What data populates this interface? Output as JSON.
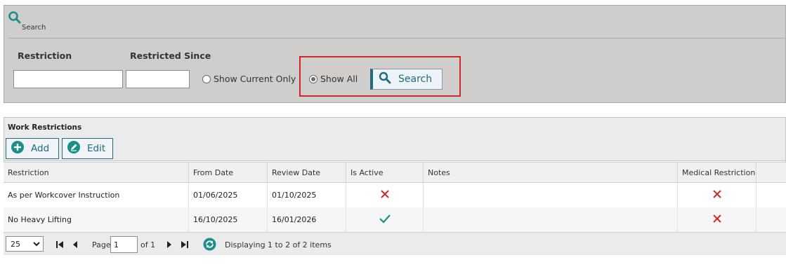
{
  "search_panel": {
    "header_label": "Search",
    "restriction_label": "Restriction",
    "restricted_since_label": "Restricted Since",
    "restriction_value": "",
    "restricted_since_value": "",
    "radio_current_label": "Show Current Only",
    "radio_all_label": "Show All",
    "selected_radio": "Show All",
    "search_button_label": "Search"
  },
  "grid": {
    "title": "Work Restrictions",
    "add_label": "Add",
    "edit_label": "Edit",
    "columns": [
      "Restriction",
      "From Date",
      "Review Date",
      "Is Active",
      "Notes",
      "Medical Restriction"
    ],
    "rows": [
      {
        "restriction": "As per Workcover Instruction",
        "from_date": "01/06/2025",
        "review_date": "01/10/2025",
        "is_active": "cross-icon",
        "notes": "",
        "medical_restriction": "cross-icon"
      },
      {
        "restriction": "No Heavy Lifting",
        "from_date": "16/10/2025",
        "review_date": "16/01/2026",
        "is_active": "check-icon",
        "notes": "",
        "medical_restriction": "cross-icon"
      }
    ]
  },
  "pager": {
    "page_size": "25",
    "page_label": "Page",
    "page_value": "1",
    "of_label": "of 1",
    "display_info": "Displaying 1 to 2 of 2 items"
  },
  "colors": {
    "accent": "#1e6b82",
    "teal_icon": "#1a8f8a",
    "cross": "#cc2a2a",
    "check": "#1a8f8a",
    "highlight": "#cc2a2a"
  }
}
